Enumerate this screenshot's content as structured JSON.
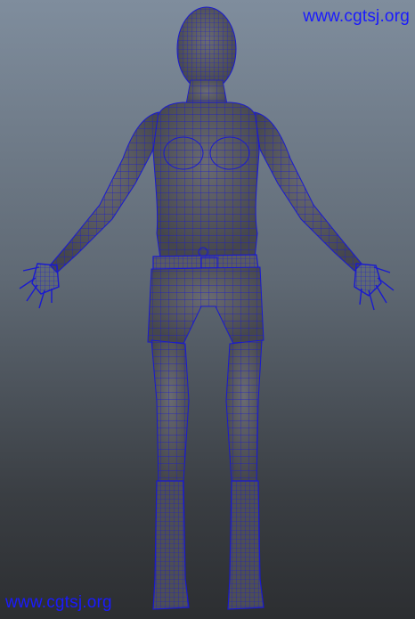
{
  "viewport": {
    "background_top": "#7f8d9d",
    "background_bottom": "#2c2e31",
    "mesh_fill": "#55565c",
    "wire_color": "#1a1ad0"
  },
  "model": {
    "icon": "female-base-mesh-wireframe",
    "pose": "A-pose, front view"
  },
  "watermarks": {
    "top_right": "www.cgtsj.org",
    "bottom_left": "www.cgtsj.org",
    "color": "#1a1aff"
  }
}
